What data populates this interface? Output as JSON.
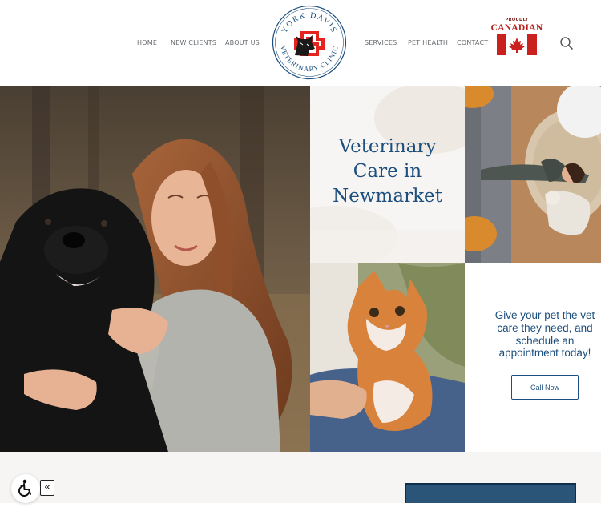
{
  "nav": {
    "left": [
      "HOME",
      "NEW CLIENTS",
      "ABOUT US"
    ],
    "right": [
      "SERVICES",
      "PET HEALTH",
      "CONTACT"
    ]
  },
  "logo": {
    "top_text": "YORK DAVIS",
    "bottom_text": "VETERINARY CLINIC"
  },
  "badge": {
    "small": "PROUDLY",
    "big": "CANADIAN"
  },
  "hero": {
    "title_lines": [
      "Veterinary",
      "Care in",
      "Newmarket"
    ]
  },
  "cta": {
    "lines": [
      "Give your pet the vet",
      "care they need, and",
      "schedule an",
      "appointment today!"
    ],
    "button": "Call Now"
  },
  "widget": {
    "collapse": "«"
  },
  "icons": {
    "search": "search-icon",
    "accessibility": "wheelchair-icon",
    "flag": "canada-flag-icon"
  },
  "colors": {
    "brand_blue": "#1c4e7e",
    "nav_gray": "#666a6e",
    "canada_red": "#c8211e"
  }
}
